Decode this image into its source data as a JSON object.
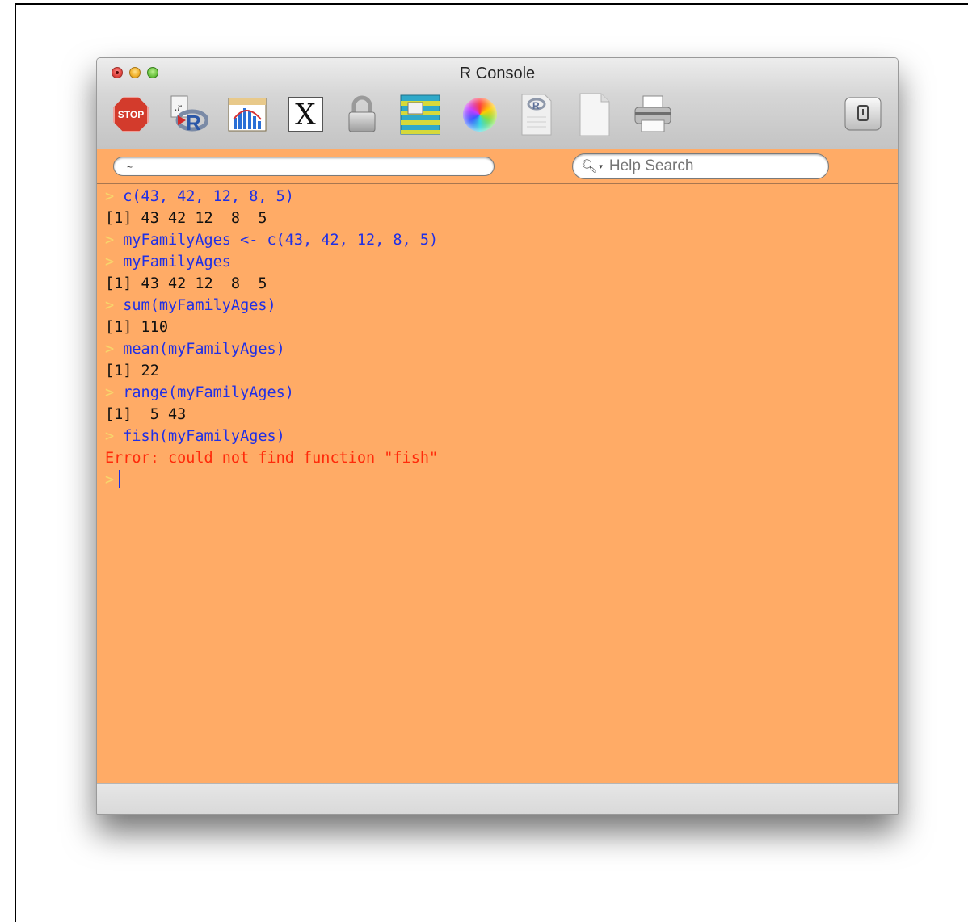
{
  "window": {
    "title": "R Console"
  },
  "toolbar": {
    "stop_label": "STOP",
    "x11_label": "X",
    "buttons": [
      {
        "name": "stop",
        "icon": "stop-sign-icon"
      },
      {
        "name": "source-script",
        "icon": "r-script-icon"
      },
      {
        "name": "quartz",
        "icon": "bar-chart-icon"
      },
      {
        "name": "x11",
        "icon": "x11-icon"
      },
      {
        "name": "authenticate",
        "icon": "padlock-icon"
      },
      {
        "name": "data-editor",
        "icon": "data-table-icon"
      },
      {
        "name": "set-colors",
        "icon": "color-wheel-icon"
      },
      {
        "name": "open-document",
        "icon": "r-document-icon"
      },
      {
        "name": "new-document",
        "icon": "blank-page-icon"
      },
      {
        "name": "print",
        "icon": "printer-icon"
      },
      {
        "name": "toggle-toolbar",
        "icon": "toolbar-toggle-icon"
      }
    ]
  },
  "search": {
    "path_value": "~",
    "help_placeholder": "Help Search"
  },
  "console": {
    "lines": [
      {
        "type": "cmd",
        "prompt": ">",
        "text": "c(43, 42, 12, 8, 5)"
      },
      {
        "type": "out",
        "text": "[1] 43 42 12  8  5"
      },
      {
        "type": "cmd",
        "prompt": ">",
        "text": "myFamilyAges <- c(43, 42, 12, 8, 5)"
      },
      {
        "type": "cmd",
        "prompt": ">",
        "text": "myFamilyAges"
      },
      {
        "type": "out",
        "text": "[1] 43 42 12  8  5"
      },
      {
        "type": "cmd",
        "prompt": ">",
        "text": "sum(myFamilyAges)"
      },
      {
        "type": "out",
        "text": "[1] 110"
      },
      {
        "type": "cmd",
        "prompt": ">",
        "text": "mean(myFamilyAges)"
      },
      {
        "type": "out",
        "text": "[1] 22"
      },
      {
        "type": "cmd",
        "prompt": ">",
        "text": "range(myFamilyAges)"
      },
      {
        "type": "out",
        "text": "[1]  5 43"
      },
      {
        "type": "cmd",
        "prompt": ">",
        "text": "fish(myFamilyAges)"
      },
      {
        "type": "err",
        "text": "Error: could not find function \"fish\""
      }
    ],
    "active_prompt": ">"
  },
  "colors": {
    "console_bg": "#ffab66",
    "command": "#1f2fe6",
    "output": "#111111",
    "error": "#ff2a0a",
    "prompt": "#f7d66b"
  }
}
